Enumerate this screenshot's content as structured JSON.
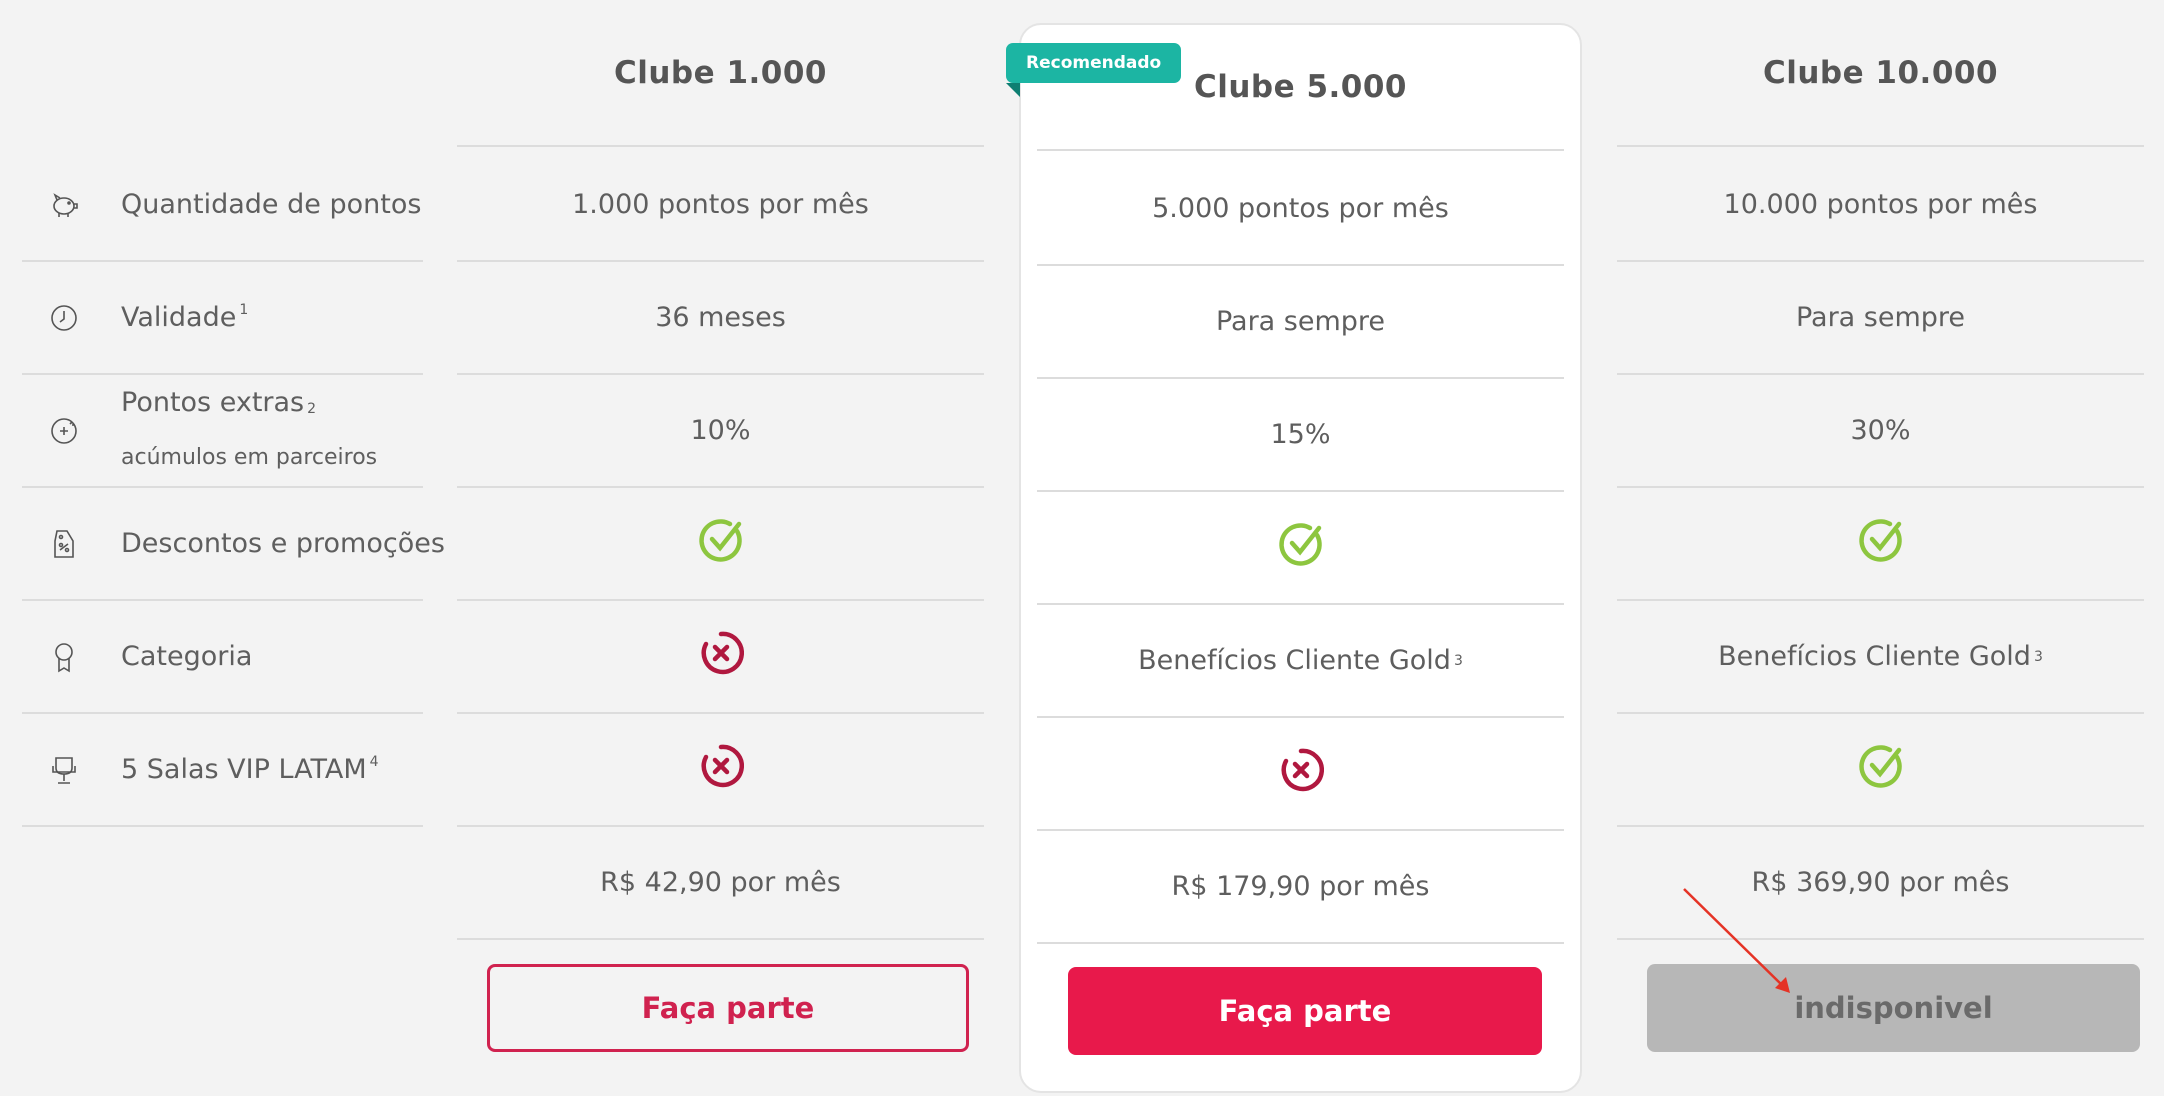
{
  "features": [
    {
      "icon": "piggy-bank-icon",
      "label": "Quantidade de pontos",
      "sup": ""
    },
    {
      "icon": "clock-icon",
      "label": "Validade",
      "sup": "1"
    },
    {
      "icon": "points-plus-icon",
      "label": "Pontos extras",
      "sup": "2",
      "sub": "acúmulos em parceiros"
    },
    {
      "icon": "discount-tag-icon",
      "label": "Descontos e promoções",
      "sup": ""
    },
    {
      "icon": "category-medal-icon",
      "label": "Categoria",
      "sup": ""
    },
    {
      "icon": "vip-lounge-chair-icon",
      "label": "5 Salas VIP LATAM",
      "sup": "4"
    }
  ],
  "plans": [
    {
      "name": "Clube 1.000",
      "points": "1.000 pontos por mês",
      "validity": "36 meses",
      "extra": "10%",
      "discounts": "check",
      "category": "cross",
      "vip": "cross",
      "price": "R$ 42,90 por mês",
      "button": "Faça parte"
    },
    {
      "name": "Clube 5.000",
      "badge": "Recomendado",
      "points": "5.000 pontos por mês",
      "validity": "Para sempre",
      "extra": "15%",
      "discounts": "check",
      "category": "Benefícios Cliente Gold",
      "category_sup": "3",
      "vip": "cross",
      "price": "R$ 179,90 por mês",
      "button": "Faça parte"
    },
    {
      "name": "Clube 10.000",
      "points": "10.000 pontos por mês",
      "validity": "Para sempre",
      "extra": "30%",
      "discounts": "check",
      "category": "Benefícios Cliente Gold",
      "category_sup": "3",
      "vip": "check",
      "price": "R$ 369,90 por mês",
      "button": "indisponivel"
    }
  ],
  "colors": {
    "accent": "#e8194b",
    "check": "#8dc63f",
    "cross": "#b0183f",
    "badge": "#1cb5a3",
    "disabled": "#b7b7b7",
    "annotation_arrow": "#e53325"
  }
}
